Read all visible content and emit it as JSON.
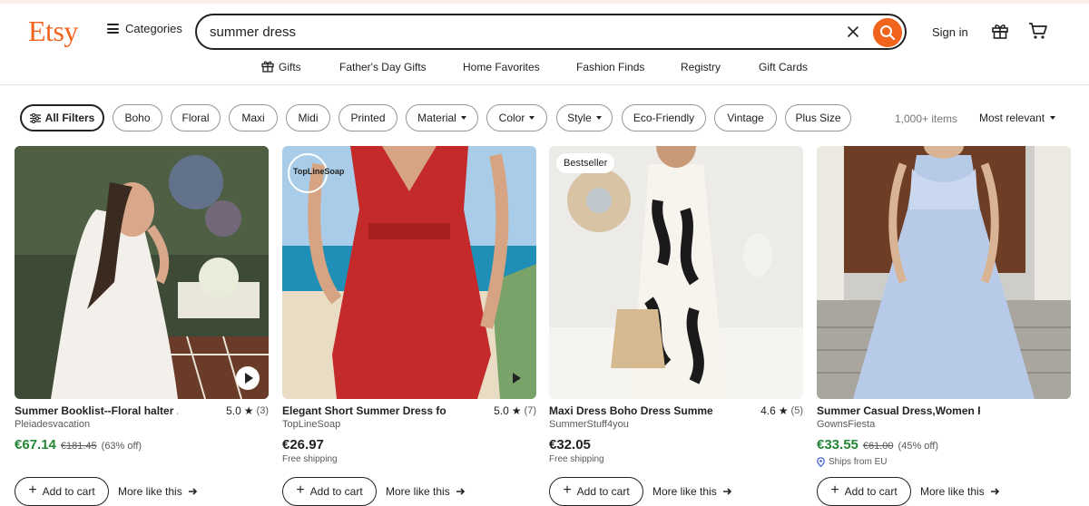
{
  "header": {
    "logo": "Etsy",
    "categories_label": "Categories",
    "search_value": "summer dress",
    "signin_label": "Sign in"
  },
  "nav": [
    "Gifts",
    "Father's Day Gifts",
    "Home Favorites",
    "Fashion Finds",
    "Registry",
    "Gift Cards"
  ],
  "filters": {
    "all": "All Filters",
    "pills": [
      "Boho",
      "Floral",
      "Maxi",
      "Midi",
      "Printed",
      "Material",
      "Color",
      "Style",
      "Eco-Friendly",
      "Vintage",
      "Plus Size"
    ],
    "count": "1,000+ items",
    "sort": "Most relevant"
  },
  "products": [
    {
      "title": "Summer Booklist--Floral halter ...",
      "rating": "5.0",
      "reviews": "(3)",
      "shop": "Pleiadesvacation",
      "price": "€67.14",
      "original": "€181.45",
      "discount": "(63% off)",
      "shipping": "",
      "badge": "",
      "add_label": "Add to cart",
      "more_label": "More like this"
    },
    {
      "title": "Elegant Short Summer Dress for ...",
      "rating": "5.0",
      "reviews": "(7)",
      "shop": "TopLineSoap",
      "price": "€26.97",
      "original": "",
      "discount": "",
      "shipping": "Free shipping",
      "badge": "",
      "watermark": "TopLineSoap",
      "add_label": "Add to cart",
      "more_label": "More like this"
    },
    {
      "title": "Maxi Dress Boho Dress Summer ...",
      "rating": "4.6",
      "reviews": "(5)",
      "shop": "SummerStuff4you",
      "price": "€32.05",
      "original": "",
      "discount": "",
      "shipping": "Free shipping",
      "badge": "Bestseller",
      "add_label": "Add to cart",
      "more_label": "More like this"
    },
    {
      "title": "Summer Casual Dress,Women Fl...",
      "rating": "",
      "reviews": "",
      "shop": "GownsFiesta",
      "price": "€33.55",
      "original": "€61.00",
      "discount": "(45% off)",
      "shipping": "Ships from EU",
      "badge": "",
      "add_label": "Add to cart",
      "more_label": "More like this"
    }
  ],
  "colors": {
    "brand": "#f1641e",
    "sale_price": "#258635",
    "text": "#222222"
  }
}
